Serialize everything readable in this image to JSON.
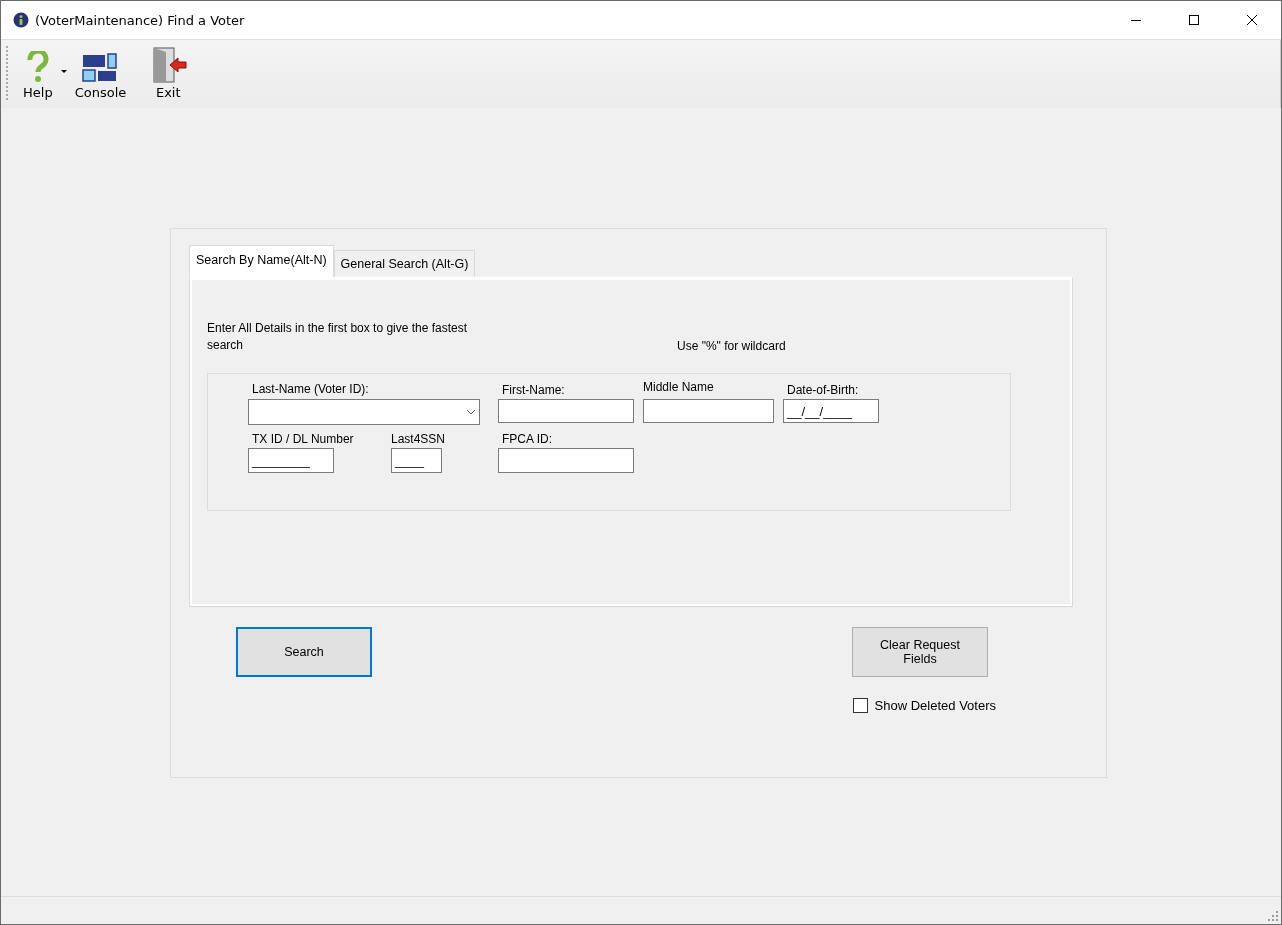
{
  "window": {
    "title": "(VoterMaintenance) Find a Voter"
  },
  "toolbar": [
    {
      "label": "Help",
      "kind": "split"
    },
    {
      "label": "Console",
      "kind": "plain"
    },
    {
      "label": "Exit",
      "kind": "plain"
    }
  ],
  "tabs": [
    {
      "label": "Search By Name(Alt-N)",
      "selected": true
    },
    {
      "label": "General Search (Alt-G)",
      "selected": false
    }
  ],
  "hint": "Enter All Details in the first box to give the fastest search",
  "wildcard_note": "Use \"%\" for wildcard",
  "fields": [
    {
      "label": "Last-Name (Voter ID):",
      "kind": "combo"
    },
    {
      "label": "First-Name:",
      "kind": "text"
    },
    {
      "label": "Middle Name",
      "kind": "text"
    },
    {
      "label": "Date-of-Birth:",
      "kind": "text",
      "value": "__/__/____"
    },
    {
      "label": "TX ID / DL Number",
      "kind": "text",
      "value": "________"
    },
    {
      "label": "Last4SSN",
      "kind": "text",
      "value": "____"
    },
    {
      "label": "FPCA ID:",
      "kind": "text"
    }
  ],
  "buttons": {
    "search": "Search",
    "clear": "Clear Request Fields"
  },
  "show_deleted": {
    "label": "Show Deleted Voters",
    "checked": false
  }
}
